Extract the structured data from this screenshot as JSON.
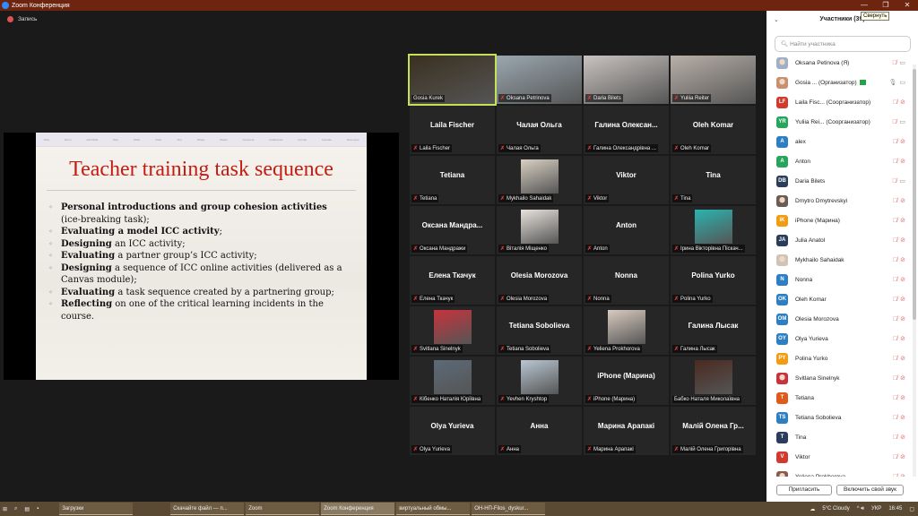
{
  "window": {
    "title": "Zoom Конференция",
    "tooltip": "Свернуть",
    "controls": [
      "—",
      "❐",
      "✕"
    ]
  },
  "recording": {
    "label": "Запись"
  },
  "slide": {
    "toolbar": [
      "View",
      "Zoom",
      "Add Slide",
      "Play",
      "Table",
      "Chart",
      "Text",
      "Shape",
      "Media",
      "Comment",
      "Collaborate",
      "Format",
      "Animate",
      "Document"
    ],
    "title": "Teacher training task sequence",
    "bullets": [
      {
        "bold": "Personal introductions and group cohesion activities",
        "rest": " (ice-breaking task);"
      },
      {
        "bold": "Evaluating a model ICC activity",
        "rest": ";"
      },
      {
        "bold": "Designing",
        "rest": " an ICC activity;"
      },
      {
        "bold": "Evaluating",
        "rest": " a partner group’s ICC activity;"
      },
      {
        "bold": "Designing",
        "rest": " a sequence of ICC online activities (delivered as a Canvas module);"
      },
      {
        "bold": "Evaluating",
        "rest": " a  task sequence created by a partnering group;"
      },
      {
        "bold": "Reflecting",
        "rest": " on one of the critical learning incidents in the course."
      }
    ]
  },
  "gallery": [
    {
      "label": "Gosia Kurek",
      "type": "video",
      "active": true,
      "muted": false,
      "color": "#3a3020"
    },
    {
      "label": "Oksana Petrinova",
      "type": "video",
      "color": "#9aa7b0"
    },
    {
      "label": "Daria Bilets",
      "type": "video",
      "color": "#c9c3c0"
    },
    {
      "label": "Yuliia Reiter",
      "type": "video",
      "color": "#b8b0a8"
    },
    {
      "name": "Laila Fischer",
      "label": "Laila Fischer"
    },
    {
      "name": "Чалая Ольга",
      "label": "Чалая Ольга"
    },
    {
      "name": "Галина  Олексан...",
      "label": "Галина Олександрівна ..."
    },
    {
      "name": "Oleh Komar",
      "label": "Oleh Komar"
    },
    {
      "name": "Tetiana",
      "label": "Tetiana"
    },
    {
      "label": "Mykhailo Sahaidak",
      "type": "photo",
      "color": "#d8cfc2"
    },
    {
      "name": "Viktor",
      "label": "Viktor"
    },
    {
      "name": "Tina",
      "label": "Tina"
    },
    {
      "name": "Оксана  Мандра...",
      "label": "Оксана Мандражи"
    },
    {
      "label": "Віталія Міщенко",
      "type": "photo",
      "color": "#e8e2dc"
    },
    {
      "name": "Anton",
      "label": "Anton"
    },
    {
      "label": "Ірина Вікторівна Піскач...",
      "type": "photo",
      "color": "#2bb3b0"
    },
    {
      "name": "Елена Ткачук",
      "label": "Елена Ткачук"
    },
    {
      "name": "Olesia Morozova",
      "label": "Olesia Morozova"
    },
    {
      "name": "Nonna",
      "label": "Nonna"
    },
    {
      "name": "Polina Yurko",
      "label": "Polina Yurko"
    },
    {
      "label": "Svitlana Sinelnyk",
      "type": "photo",
      "color": "#c8323c"
    },
    {
      "name": "Tetiana Sobolieva",
      "label": "Tetiana Sobolieva"
    },
    {
      "label": "Yeliena Prokhorova",
      "type": "photo",
      "color": "#d9cbbf"
    },
    {
      "name": "Галина Лысак",
      "label": "Галина Лысак"
    },
    {
      "label": "Кібенко Наталія Юріївна",
      "type": "photo",
      "color": "#5d6a78"
    },
    {
      "label": "Yevhen Kryshtop",
      "type": "photo",
      "color": "#b9c6d2"
    },
    {
      "name": "iPhone (Марина)",
      "label": "iPhone (Марина)"
    },
    {
      "label": "Бабко Наталя Миколаївна",
      "type": "photo",
      "color": "#4a2a20",
      "muted": false
    },
    {
      "name": "Olya Yurieva",
      "label": "Olya Yurieva"
    },
    {
      "name": "Анна",
      "label": "Анна"
    },
    {
      "name": "Марина Арапакі",
      "label": "Марина Арапакі"
    },
    {
      "name": "Малій Олена Гр...",
      "label": "Малій Олена Григорівна"
    }
  ],
  "panel": {
    "title": "Участники (39)",
    "search_placeholder": "Найти участника",
    "invite": "Пригласить",
    "unmute_self": "Включить свой звук",
    "participants": [
      {
        "name": "Oksana Petinova (Я)",
        "photo": "#9fb0c4",
        "mic": "muted",
        "cam": "on"
      },
      {
        "name": "Gosia ...  (Организатор)",
        "photo": "#c98f6e",
        "mic": "on",
        "cam": "on",
        "host": true
      },
      {
        "name": "Laila Fisc...  (Соорганизатор)",
        "initials": "LF",
        "color": "#d23a2e",
        "mic": "muted",
        "cam": "off"
      },
      {
        "name": "Yuliia Rei...  (Соорганизатор)",
        "initials": "YR",
        "color": "#27a55a",
        "mic": "muted",
        "cam": "on"
      },
      {
        "name": "alex",
        "initials": "A",
        "color": "#2d7fc4",
        "mic": "muted",
        "cam": "off"
      },
      {
        "name": "Anton",
        "initials": "A",
        "color": "#27a55a",
        "mic": "muted",
        "cam": "off"
      },
      {
        "name": "Daria Bilets",
        "initials": "DB",
        "color": "#2a3e5c",
        "mic": "muted",
        "cam": "on"
      },
      {
        "name": "Dmytro Dmytrevskyi",
        "photo": "#6b5d52",
        "mic": "muted",
        "cam": "off"
      },
      {
        "name": "iPhone (Марина)",
        "initials": "iK",
        "color": "#f39c12",
        "mic": "muted",
        "cam": "off"
      },
      {
        "name": "Julia Anatol",
        "initials": "JA",
        "color": "#2a3e5c",
        "mic": "muted",
        "cam": "off"
      },
      {
        "name": "Mykhailo Sahaidak",
        "photo": "#d0c4b4",
        "mic": "muted",
        "cam": "off"
      },
      {
        "name": "Nonna",
        "initials": "N",
        "color": "#2d7fc4",
        "mic": "muted",
        "cam": "off"
      },
      {
        "name": "Oleh Komar",
        "initials": "OK",
        "color": "#2d7fc4",
        "mic": "muted",
        "cam": "off"
      },
      {
        "name": "Olesia Morozova",
        "initials": "OM",
        "color": "#2d7fc4",
        "mic": "muted",
        "cam": "off"
      },
      {
        "name": "Olya Yurieva",
        "initials": "OY",
        "color": "#2d7fc4",
        "mic": "muted",
        "cam": "off"
      },
      {
        "name": "Polina Yurko",
        "initials": "PY",
        "color": "#f39c12",
        "mic": "muted",
        "cam": "off"
      },
      {
        "name": "Svitlana Sinelnyk",
        "photo": "#c8323c",
        "mic": "muted",
        "cam": "off"
      },
      {
        "name": "Tetiana",
        "initials": "T",
        "color": "#e05a1c",
        "mic": "muted",
        "cam": "off"
      },
      {
        "name": "Tetiana Sobolieva",
        "initials": "TS",
        "color": "#2d7fc4",
        "mic": "muted",
        "cam": "off"
      },
      {
        "name": "Tina",
        "initials": "T",
        "color": "#2a3e5c",
        "mic": "muted",
        "cam": "off"
      },
      {
        "name": "Viktor",
        "initials": "V",
        "color": "#d23a2e",
        "mic": "muted",
        "cam": "off"
      },
      {
        "name": "Yeliena Prokhorova",
        "photo": "#8a5a4a",
        "mic": "muted",
        "cam": "off"
      }
    ]
  },
  "taskbar": {
    "apps": [
      {
        "label": "Загрузки"
      },
      {
        "label": "Скачайте файл — п..."
      },
      {
        "label": "Zoom"
      },
      {
        "label": "Zoom Конференция",
        "active": true
      },
      {
        "label": "виртуальный обмы..."
      },
      {
        "label": "ОН-НП-Filos_dyskur..."
      }
    ],
    "weather": "5°C  Cloudy",
    "lang": "УКР",
    "time": "16:45"
  }
}
